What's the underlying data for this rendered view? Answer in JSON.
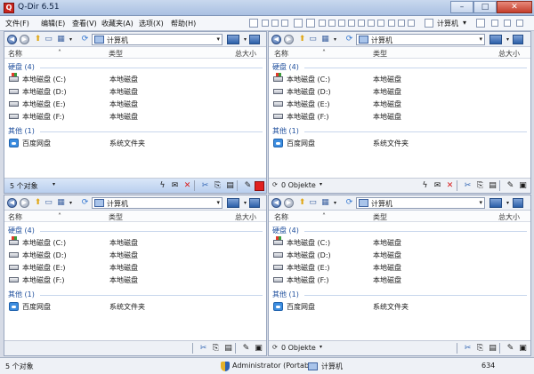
{
  "window": {
    "title": "Q-Dir 6.51"
  },
  "menu": [
    "文件(F)",
    "编辑(E)",
    "查看(V)",
    "收藏夹(A)",
    "选项(X)",
    "帮助(H)"
  ],
  "menu_right": {
    "location": "计算机"
  },
  "columns": {
    "name": "名称",
    "type": "类型",
    "size": "总大小"
  },
  "panes": [
    {
      "path": "计算机",
      "count": "5 个对象",
      "active": true
    },
    {
      "path": "计算机",
      "count": "0 Objekte",
      "active": false
    },
    {
      "path": "计算机",
      "count": "",
      "active": false
    },
    {
      "path": "计算机",
      "count": "0 Objekte",
      "active": false
    }
  ],
  "groups": {
    "disks_header": "硬盘 (4)",
    "other_header": "其他 (1)"
  },
  "drives": [
    {
      "name": "本地磁盘 (C:)",
      "type": "本地磁盘"
    },
    {
      "name": "本地磁盘 (D:)",
      "type": "本地磁盘"
    },
    {
      "name": "本地磁盘 (E:)",
      "type": "本地磁盘"
    },
    {
      "name": "本地磁盘 (F:)",
      "type": "本地磁盘"
    }
  ],
  "other": {
    "name": "百度网盘",
    "type": "系统文件夹"
  },
  "statusbar": {
    "count": "5 个对象",
    "user": "Administrator (Portabel",
    "location": "计算机",
    "number": "634"
  },
  "colors": {
    "accent": "#1e4e9c",
    "titlebar": "#a9c0e2",
    "close": "#c33d2b"
  },
  "icons": [
    "back-icon",
    "forward-icon",
    "up-icon",
    "refresh-icon",
    "drive-icon",
    "cloud-icon",
    "computer-icon",
    "shield-icon"
  ]
}
